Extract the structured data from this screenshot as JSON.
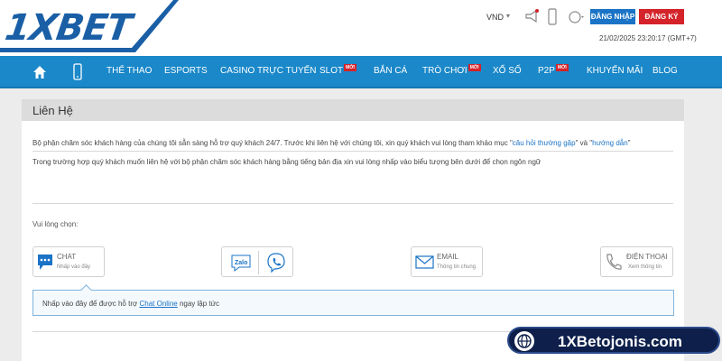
{
  "header": {
    "logo_text": "1XBET",
    "currency": "VND",
    "login_label": "ĐĂNG NHẬP",
    "register_label": "ĐĂNG KÝ",
    "datetime": "21/02/2025 23:20:17 (GMT+7)",
    "icons": [
      "megaphone-icon",
      "mobile-icon",
      "globe-icon"
    ]
  },
  "nav": {
    "items": [
      {
        "label": "THỂ THAO",
        "badge": ""
      },
      {
        "label": "ESPORTS",
        "badge": ""
      },
      {
        "label": "CASINO TRỰC TUYẾN",
        "badge": ""
      },
      {
        "label": "SLOT",
        "badge": "MỚI"
      },
      {
        "label": "BẮN CÁ",
        "badge": ""
      },
      {
        "label": "TRÒ CHƠI",
        "badge": "MỚI"
      },
      {
        "label": "XỔ SỐ",
        "badge": ""
      },
      {
        "label": "P2P",
        "badge": "MỚI"
      },
      {
        "label": "KHUYẾN MÃI",
        "badge": ""
      },
      {
        "label": "BLOG",
        "badge": ""
      }
    ]
  },
  "main": {
    "title": "Liên Hệ",
    "intro_prefix": "Bộ phận chăm sóc khách hàng của chúng tôi sẵn sàng hỗ trợ quý khách 24/7. Trước khi liên hệ với chúng tôi, xin quý khách vui lòng tham khảo mục \"",
    "faq_link": "câu hỏi thường gặp",
    "intro_mid": "\" và \"",
    "guide_link": "hướng dẫn",
    "intro_suffix": "\"",
    "local_lang_text": "Trong trường hợp quý khách muốn liên hệ với bộ phận chăm sóc khách hàng bằng tiếng bản địa xin vui lòng nhấp vào biểu tượng bên dưới để chọn ngôn ngữ",
    "choose_label": "Vui lòng chọn:",
    "options": {
      "chat": {
        "title": "CHAT",
        "sub": "Nhấp vào đây"
      },
      "zalo": {
        "label": "Zalo"
      },
      "email": {
        "title": "EMAIL",
        "sub": "Thông tin chung"
      },
      "phone": {
        "title": "ĐIỆN THOẠI",
        "sub": "Xem thông tin"
      }
    },
    "info_prefix": "Nhấp vào đây để được hỗ trợ ",
    "info_link": "Chat Online",
    "info_suffix": " ngay lập tức"
  },
  "watermark": {
    "text": "1XBetojonis.com"
  },
  "colors": {
    "brand_blue": "#1a88c9",
    "login": "#1a73c6",
    "register": "#d4232a"
  }
}
